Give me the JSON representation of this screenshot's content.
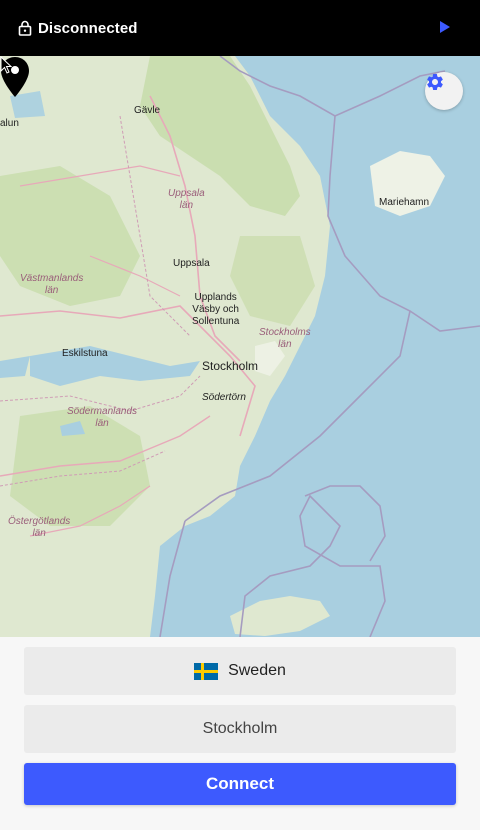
{
  "topbar": {
    "status": "Disconnected",
    "lock_icon": "lock-icon",
    "play_icon": "play-icon"
  },
  "map": {
    "settings_icon": "gear-icon",
    "marker_icon": "map-pin-icon",
    "labels": {
      "gavle": "Gävle",
      "falun": "alun",
      "uppsala_lan": "Uppsala\nlän",
      "uppsala": "Uppsala",
      "vastmanlands_lan": "Västmanlands\nlän",
      "upplands_vasby": "Upplands\nVäsby och\nSollentuna",
      "eskilstuna": "Eskilstuna",
      "stockholms_lan": "Stockholms\nlän",
      "stockholm": "Stockholm",
      "sodertorn": "Södertörn",
      "sodermanlands_lan": "Södermanlands\nlän",
      "ostergotlands_lan": "Östergötlands\nlän",
      "mariehamn": "Mariehamn"
    },
    "colors": {
      "water": "#a9cfe0",
      "land": "#dfe8d0",
      "forest": "#c7dcaa",
      "road": "#e7a9b9"
    }
  },
  "panel": {
    "country": "Sweden",
    "city": "Stockholm",
    "connect_label": "Connect",
    "accent": "#3d5afe"
  }
}
